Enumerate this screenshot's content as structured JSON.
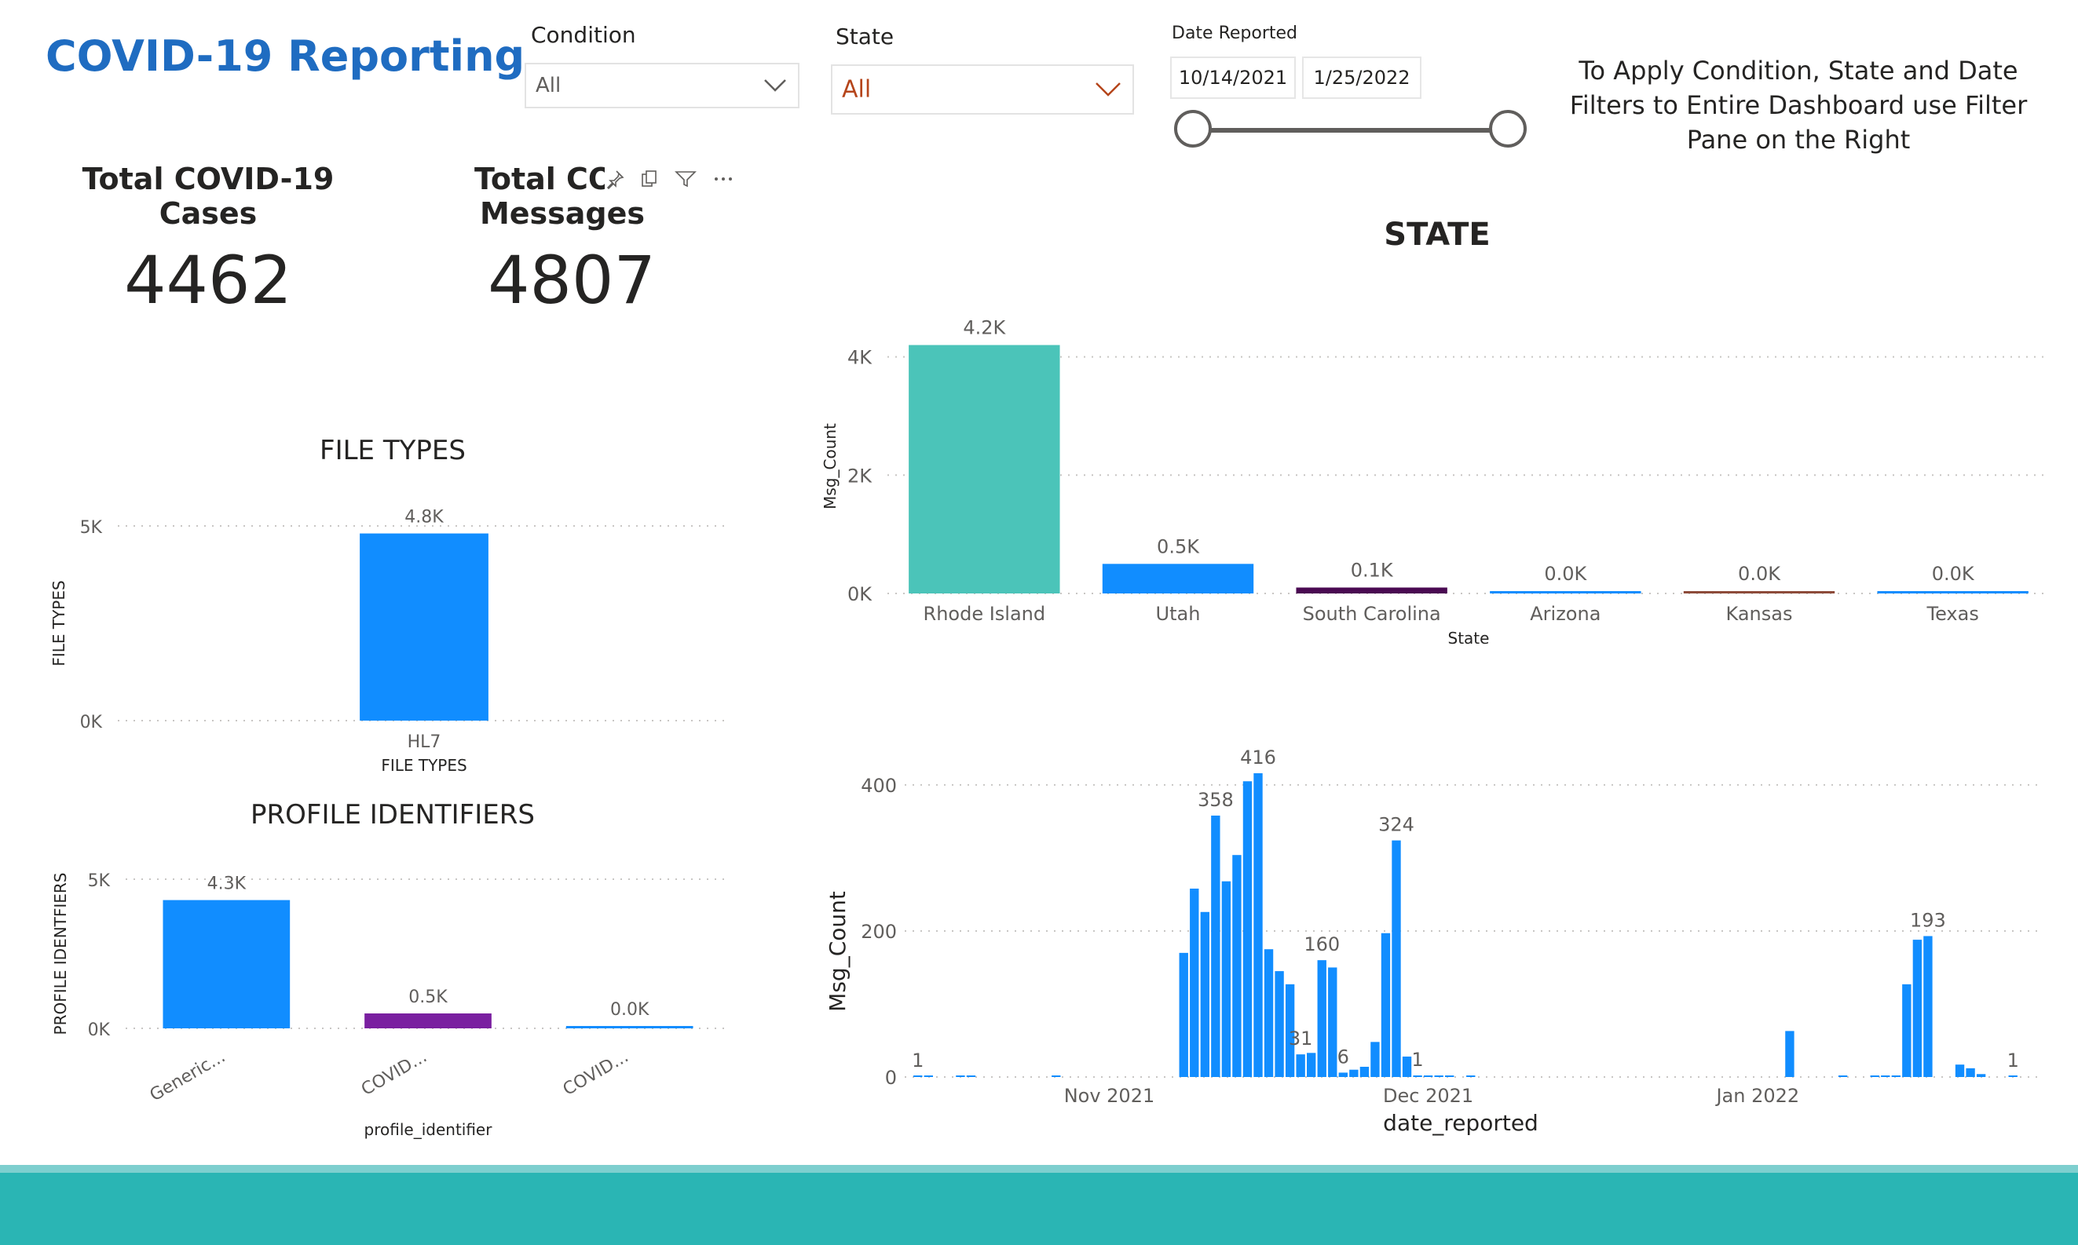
{
  "header": {
    "title": "COVID-19 Reporting"
  },
  "filters": {
    "condition": {
      "label": "Condition",
      "value": "All"
    },
    "state": {
      "label": "State",
      "value": "All"
    },
    "date": {
      "label": "Date Reported",
      "start": "10/14/2021",
      "end": "1/25/2022",
      "range_fraction": [
        0.0,
        1.0
      ]
    },
    "note": "To Apply Condition, State and Date Filters to Entire Dashboard use Filter Pane on the Right"
  },
  "cards": [
    {
      "title_line1": "Total COVID-19",
      "title_line2": "Cases",
      "value": "4462"
    },
    {
      "title_line1": "Total COV",
      "title_line2": "Messages",
      "value": "4807"
    }
  ],
  "colors": {
    "title_blue": "#1f6cc1",
    "bar_blue": "#118dff",
    "teal": "#4bc4b9",
    "dark_purple": "#4a0a52",
    "purple": "#7a1fa0",
    "brown": "#8d4b3a",
    "footer": "#2ab5b4"
  },
  "chart_data": [
    {
      "id": "file-types",
      "type": "bar",
      "title": "FILE TYPES",
      "xlabel": "FILE TYPES",
      "ylabel": "FILE TYPES",
      "categories": [
        "HL7"
      ],
      "values": [
        4807
      ],
      "data_labels": [
        "4.8K"
      ],
      "yticks": [
        "0K",
        "5K"
      ],
      "ytick_values": [
        0,
        5000
      ],
      "ylim": [
        0,
        5000
      ],
      "grid": true
    },
    {
      "id": "profile-identifiers",
      "type": "bar",
      "title": "PROFILE IDENTIFIERS",
      "xlabel": "profile_identifier",
      "ylabel": "PROFILE IDENTFIERS",
      "categories": [
        "Generic...",
        "COVID...",
        "COVID..."
      ],
      "values": [
        4300,
        500,
        20
      ],
      "data_labels": [
        "4.3K",
        "0.5K",
        "0.0K"
      ],
      "colors": [
        "#118dff",
        "#7a1fa0",
        "#118dff"
      ],
      "yticks": [
        "0K",
        "5K"
      ],
      "ytick_values": [
        0,
        5000
      ],
      "ylim": [
        0,
        5000
      ],
      "grid": true
    },
    {
      "id": "state",
      "type": "bar",
      "title": "STATE",
      "xlabel": "State",
      "ylabel": "Msg_Count",
      "categories": [
        "Rhode Island",
        "Utah",
        "South Carolina",
        "Arizona",
        "Kansas",
        "Texas"
      ],
      "values": [
        4200,
        500,
        100,
        10,
        10,
        10
      ],
      "data_labels": [
        "4.2K",
        "0.5K",
        "0.1K",
        "0.0K",
        "0.0K",
        "0.0K"
      ],
      "colors": [
        "#4bc4b9",
        "#118dff",
        "#4a0a52",
        "#118dff",
        "#8d4b3a",
        "#118dff"
      ],
      "yticks": [
        "0K",
        "2K",
        "4K"
      ],
      "ytick_values": [
        0,
        2000,
        4000
      ],
      "ylim": [
        0,
        4300
      ],
      "grid": true
    },
    {
      "id": "date-reported",
      "type": "bar",
      "title": "",
      "xlabel": "date_reported",
      "ylabel": "Msg_Count",
      "x_start": "2021-10-14",
      "x_end": "2022-01-25",
      "xticks": [
        "Nov 2021",
        "Dec 2021",
        "Jan 2022"
      ],
      "xtick_dates": [
        "2021-11-01",
        "2021-12-01",
        "2022-01-01"
      ],
      "yticks": [
        "0",
        "200",
        "400"
      ],
      "ytick_values": [
        0,
        200,
        400
      ],
      "ylim": [
        0,
        430
      ],
      "grid": true,
      "dates": [
        "2021-10-14",
        "2021-10-15",
        "2021-10-18",
        "2021-10-19",
        "2021-10-27",
        "2021-11-08",
        "2021-11-09",
        "2021-11-10",
        "2021-11-11",
        "2021-11-12",
        "2021-11-13",
        "2021-11-14",
        "2021-11-15",
        "2021-11-16",
        "2021-11-17",
        "2021-11-18",
        "2021-11-19",
        "2021-11-20",
        "2021-11-21",
        "2021-11-22",
        "2021-11-23",
        "2021-11-24",
        "2021-11-25",
        "2021-11-26",
        "2021-11-27",
        "2021-11-28",
        "2021-11-29",
        "2021-11-30",
        "2021-12-01",
        "2021-12-02",
        "2021-12-03",
        "2021-12-05",
        "2022-01-04",
        "2022-01-09",
        "2022-01-12",
        "2022-01-13",
        "2022-01-14",
        "2022-01-15",
        "2022-01-16",
        "2022-01-17",
        "2022-01-20",
        "2022-01-21",
        "2022-01-22",
        "2022-01-25"
      ],
      "values": [
        1,
        1,
        1,
        1,
        1,
        170,
        258,
        226,
        358,
        268,
        304,
        405,
        416,
        175,
        145,
        127,
        31,
        33,
        160,
        150,
        6,
        10,
        14,
        48,
        197,
        324,
        28,
        2,
        1,
        1,
        1,
        1,
        63,
        1,
        1,
        2,
        2,
        127,
        188,
        193,
        17,
        12,
        4,
        1
      ],
      "annotations": [
        {
          "date": "2021-10-14",
          "label": "1"
        },
        {
          "date": "2021-11-11",
          "label": "358"
        },
        {
          "date": "2021-11-15",
          "label": "416"
        },
        {
          "date": "2021-11-19",
          "label": "31"
        },
        {
          "date": "2021-11-21",
          "label": "160"
        },
        {
          "date": "2021-11-23",
          "label": "6"
        },
        {
          "date": "2021-11-28",
          "label": "324"
        },
        {
          "date": "2021-11-30",
          "label": "1"
        },
        {
          "date": "2022-01-17",
          "label": "193"
        },
        {
          "date": "2022-01-25",
          "label": "1"
        }
      ]
    }
  ]
}
